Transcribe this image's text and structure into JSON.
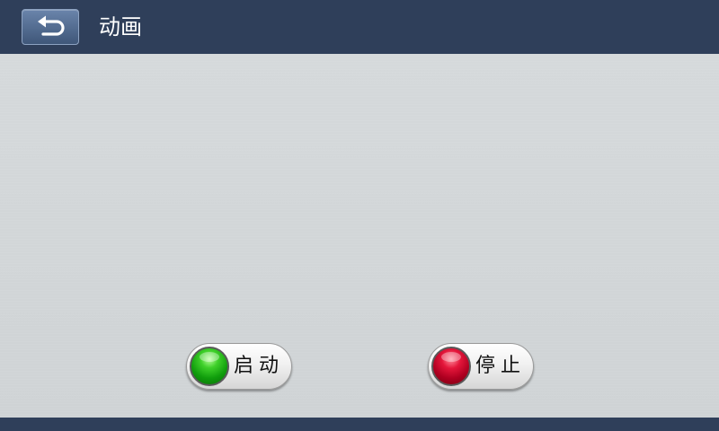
{
  "header": {
    "title": "动画",
    "back_icon": "back-arrow-icon"
  },
  "controls": {
    "start": {
      "label": "启动",
      "lamp_color": "#22b81a",
      "icon": "green-lamp-icon"
    },
    "stop": {
      "label": "停止",
      "lamp_color": "#d0102e",
      "icon": "red-lamp-icon"
    }
  },
  "colors": {
    "header_bg": "#2f3f5a",
    "content_bg": "#d2d6d8",
    "back_button_bg": "#4f6a90"
  }
}
